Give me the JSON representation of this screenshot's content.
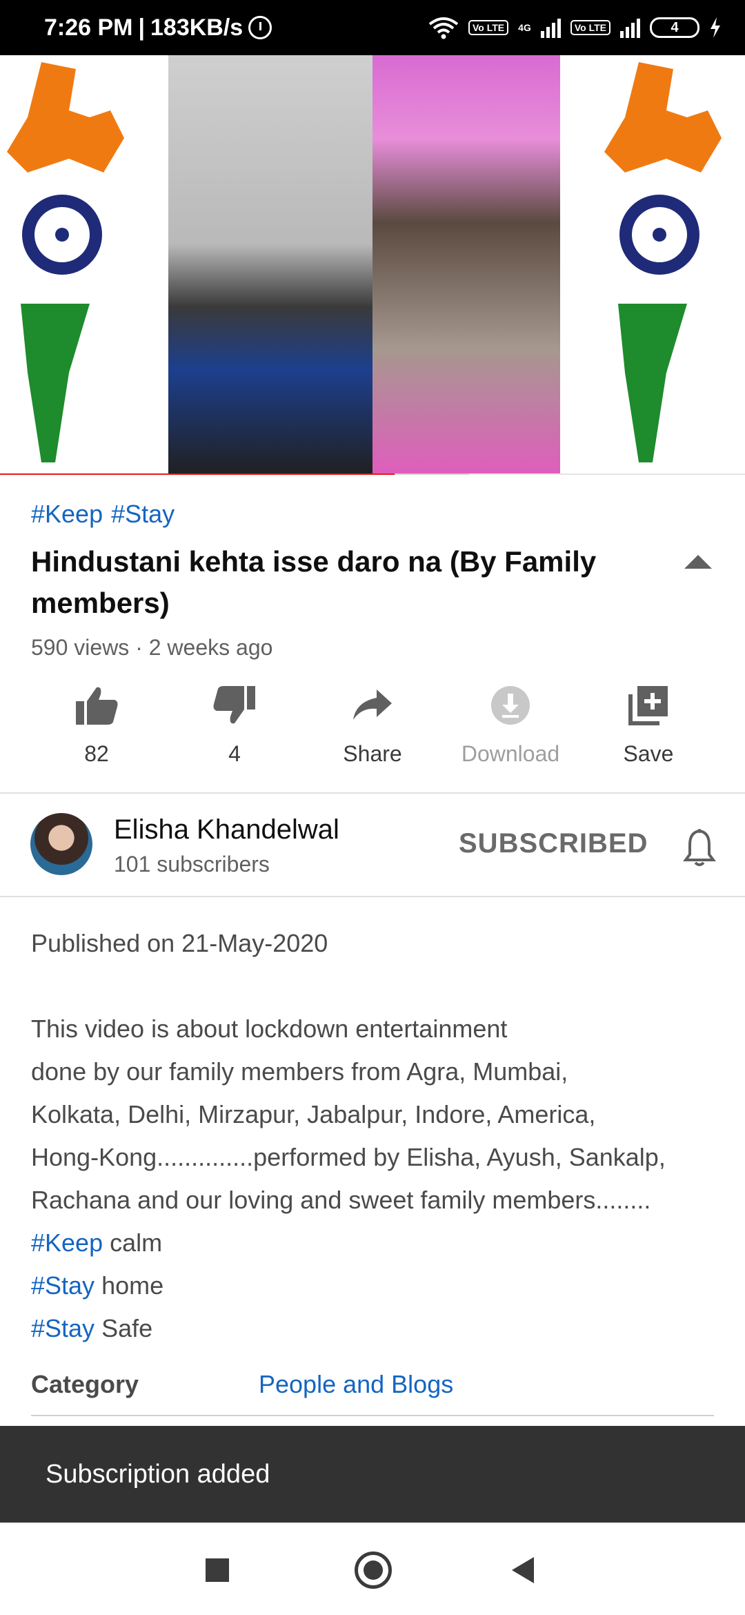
{
  "status_bar": {
    "time": "7:26 PM",
    "network_speed": "183KB/s",
    "lte1": "Vo LTE",
    "lte2": "Vo LTE",
    "net_type": "4G",
    "battery": "4"
  },
  "video": {
    "progress_fraction": 0.53,
    "buffer_fraction": 0.63
  },
  "info": {
    "hashtags": [
      "#Keep",
      "#Stay"
    ],
    "title": "Hindustani kehta isse daro na (By Family members)",
    "meta": "590 views · 2 weeks ago"
  },
  "actions": [
    {
      "label": "82",
      "icon": "thumbs-up-icon"
    },
    {
      "label": "4",
      "icon": "thumbs-down-icon"
    },
    {
      "label": "Share",
      "icon": "share-icon"
    },
    {
      "label": "Download",
      "icon": "download-icon"
    },
    {
      "label": "Save",
      "icon": "add-to-playlist-icon"
    }
  ],
  "channel": {
    "name": "Elisha Khandelwal",
    "subscribers": "101 subscribers",
    "subscribe_label": "SUBSCRIBED"
  },
  "description": {
    "published": "Published on 21-May-2020",
    "line1": "This video is about lockdown entertainment",
    "line2": "done by our family members from Agra, Mumbai,",
    "line3": "Kolkata, Delhi, Mirzapur, Jabalpur, Indore, America,",
    "line4": "Hong-Kong..............performed by Elisha, Ayush, Sankalp,",
    "line5": "Rachana and our loving and sweet family members........",
    "tag1": "#Keep",
    "tag1_rest": " calm",
    "tag2": "#Stay",
    "tag2_rest": " home",
    "tag3": "#Stay",
    "tag3_rest": " Safe"
  },
  "category": {
    "key": "Category",
    "value": "People and Blogs"
  },
  "snackbar": {
    "message": "Subscription added"
  },
  "colors": {
    "link": "#1565c0",
    "progress": "#e21b1b",
    "snackbar_bg": "#323232"
  }
}
